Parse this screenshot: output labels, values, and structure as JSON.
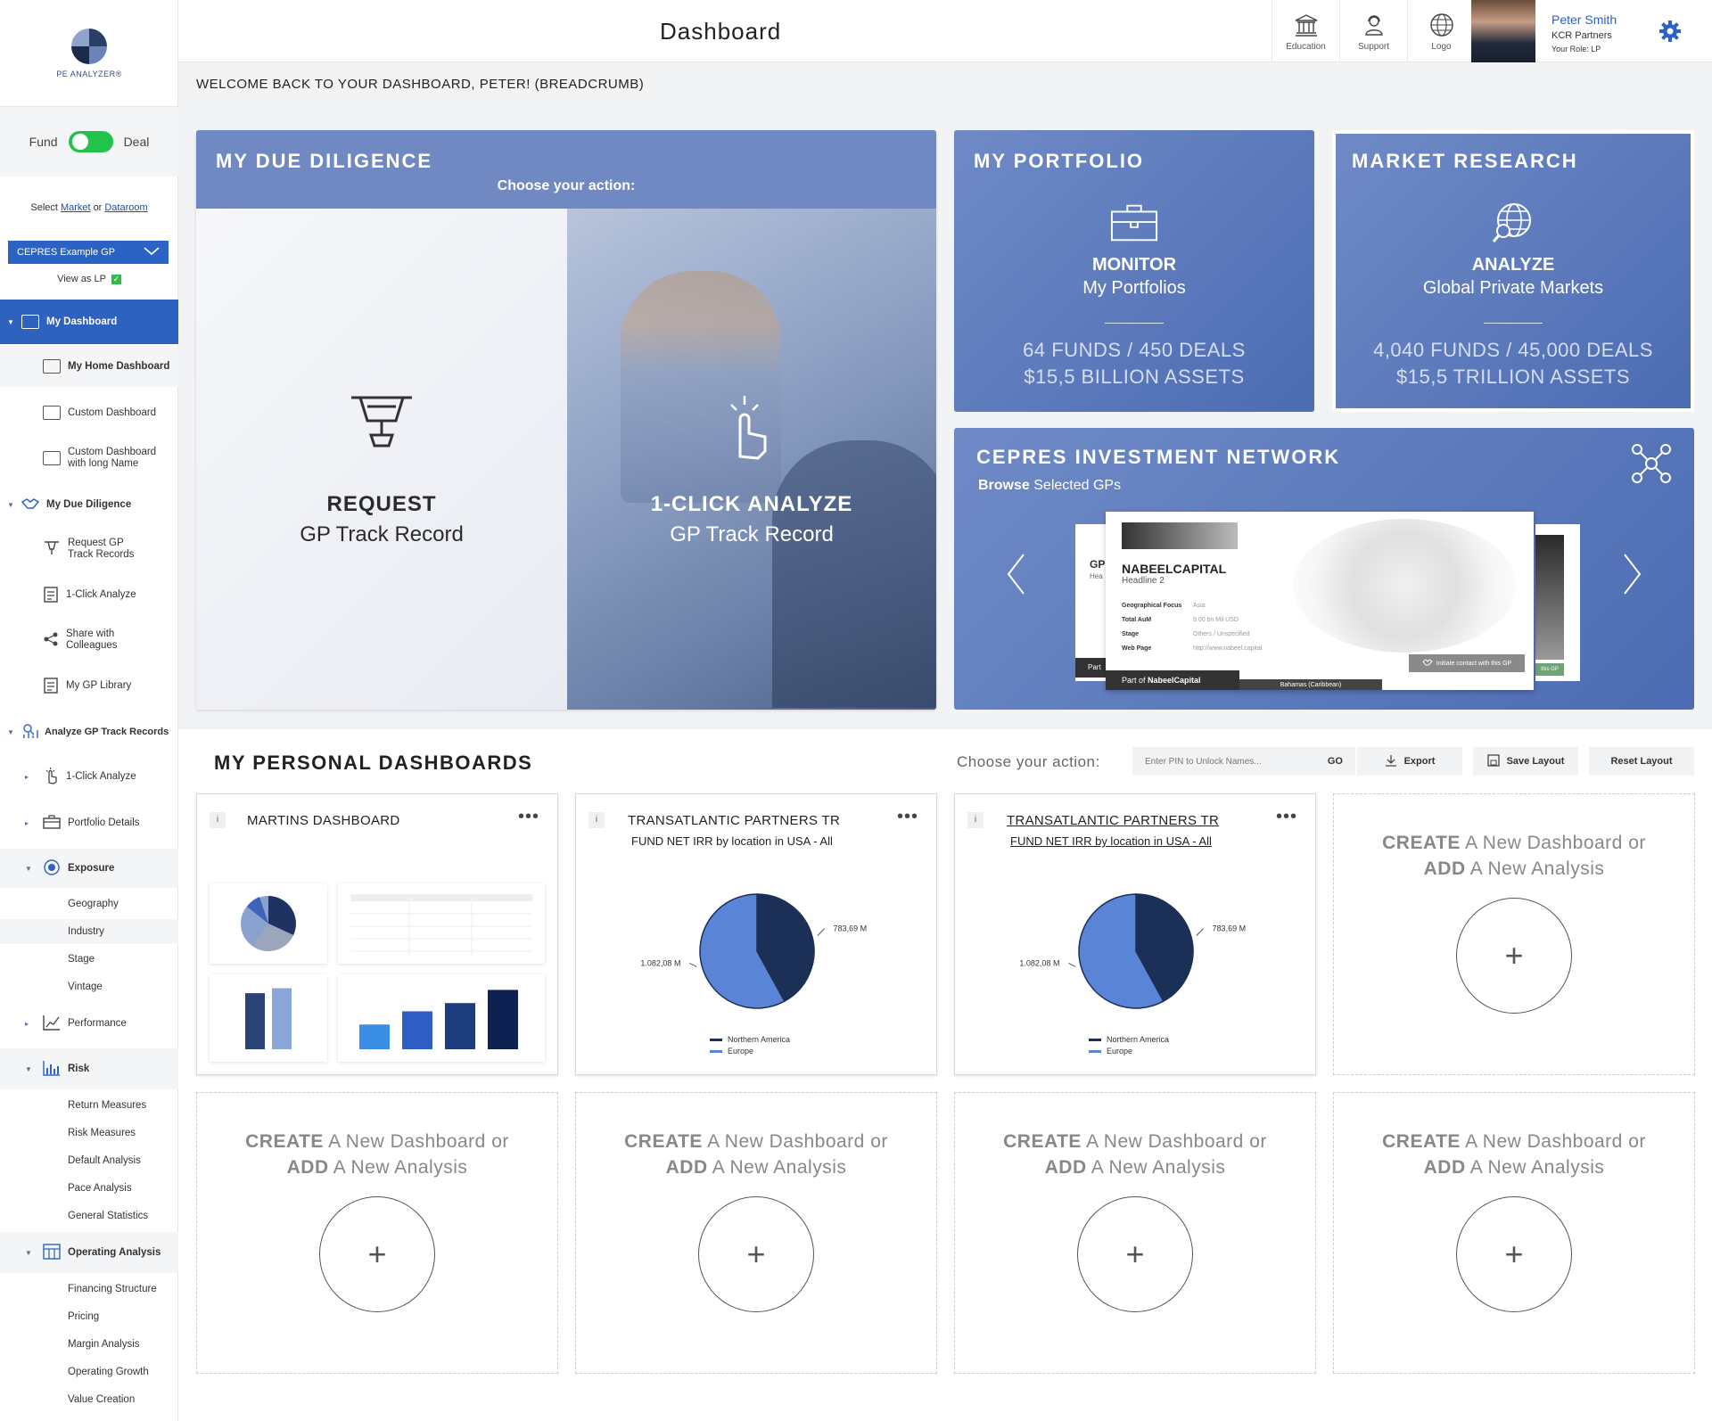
{
  "app": {
    "logo_text": "PE ANALYZER®",
    "page_title": "Dashboard",
    "breadcrumb": "WELCOME BACK TO YOUR DASHBOARD, PETER! (BREADCRUMB)"
  },
  "header": {
    "items": [
      {
        "label": "Education",
        "icon": "education-icon"
      },
      {
        "label": "Support",
        "icon": "support-icon"
      },
      {
        "label": "Logo",
        "icon": "globe-logo-icon"
      }
    ],
    "user": {
      "name": "Peter Smith",
      "company": "KCR Partners",
      "role": "Your Role: LP"
    }
  },
  "sidebar": {
    "toggle": {
      "left": "Fund",
      "right": "Deal",
      "on": true
    },
    "select_prefix": "Select",
    "select_market": "Market",
    "select_or": "or",
    "select_dataroom": "Dataroom",
    "gp_select": "CEPRES Example GP",
    "view_as_lp": "View as LP",
    "nav": {
      "my_dashboard": "My Dashboard",
      "my_home_dashboard": "My Home Dashboard",
      "custom_dashboard": "Custom Dashboard",
      "custom_dashboard_long_1": "Custom Dashboard",
      "custom_dashboard_long_2": "with long Name",
      "my_due_diligence": "My Due Diligence",
      "request_gp_1": "Request GP",
      "request_gp_2": "Track Records",
      "one_click": "1-Click Analyze",
      "share_1": "Share with",
      "share_2": "Colleagues",
      "gp_library": "My GP Library",
      "analyze_gp": "Analyze GP Track Records",
      "one_click_2": "1-Click Analyze",
      "portfolio_details": "Portfolio Details",
      "exposure": "Exposure",
      "geography": "Geography",
      "industry": "Industry",
      "stage": "Stage",
      "vintage": "Vintage",
      "performance": "Performance",
      "risk": "Risk",
      "return_measures": "Return Measures",
      "risk_measures": "Risk Measures",
      "default_analysis": "Default Analysis",
      "pace_analysis": "Pace Analysis",
      "general_statistics": "General Statistics",
      "operating_analysis": "Operating Analysis",
      "financing_structure": "Financing Structure",
      "pricing": "Pricing",
      "margin_analysis": "Margin Analysis",
      "operating_growth": "Operating Growth",
      "value_creation": "Value Creation"
    }
  },
  "due_diligence": {
    "title": "MY DUE DILIGENCE",
    "subtitle": "Choose your action:",
    "left": {
      "bold": "REQUEST",
      "text": "GP Track Record"
    },
    "right": {
      "bold": "1-CLICK ANALYZE",
      "text": "GP Track Record"
    }
  },
  "portfolio": {
    "title": "MY PORTFOLIO",
    "bold": "MONITOR",
    "text": "My Portfolios",
    "stat1": "64 FUNDS / 450 DEALS",
    "stat2": "$15,5 BILLION ASSETS"
  },
  "market_research": {
    "title": "MARKET RESEARCH",
    "bold": "ANALYZE",
    "text": "Global Private Markets",
    "stat1": "4,040 FUNDS / 45,000 DEALS",
    "stat2": "$15,5 TRILLION ASSETS"
  },
  "network": {
    "title": "CEPRES INVESTMENT NETWORK",
    "sub_bold": "Browse",
    "sub_text": "Selected GPs",
    "card": {
      "name": "NABEELCAPITAL",
      "headline": "Headline 2",
      "fields": [
        {
          "k": "Geographical Focus",
          "v": "Asia"
        },
        {
          "k": "Total AuM",
          "v": "9.00 bn Mil USD"
        },
        {
          "k": "Stage",
          "v": "Others / Unspecified"
        },
        {
          "k": "Web Page",
          "v": "http://www.nabeel.capital"
        }
      ],
      "button": "Initiate contact with this GP",
      "part_of_prefix": "Part of",
      "part_of": "NabeelCapital",
      "location": "Bahamas (Caribbean)",
      "back_label": "GP",
      "back_sub": "Hea",
      "back_part": "Part",
      "back_right_btn": "this GP"
    }
  },
  "personal": {
    "title": "MY PERSONAL DASHBOARDS",
    "choose": "Choose your action:",
    "pin_placeholder": "Enter PIN to Unlock Names...",
    "go": "GO",
    "export": "Export",
    "save_layout": "Save Layout",
    "reset_layout": "Reset Layout",
    "create_bold1": "CREATE",
    "create_text1": "A New Dashboard or",
    "create_bold2": "ADD",
    "create_text2": "A New Analysis",
    "plus": "+",
    "info": "i",
    "dots": "•••",
    "cards": [
      {
        "title": "MARTINS DASHBOARD"
      },
      {
        "title": "TRANSATLANTIC PARTNERS TR",
        "subtitle": "FUND NET IRR by location in USA - All"
      },
      {
        "title": "TRANSATLANTIC PARTNERS TR",
        "subtitle": "FUND NET IRR by location in USA - All"
      }
    ]
  },
  "chart_data": [
    {
      "type": "pie",
      "title": "FUND NET IRR by location in USA - All",
      "series": [
        {
          "name": "Northern America",
          "value": 783.69,
          "label": "783,69 M",
          "color": "#1c2f57"
        },
        {
          "name": "Europe",
          "value": 1082.08,
          "label": "1.082,08 M",
          "color": "#5a84d6"
        }
      ],
      "legend": "bottom"
    },
    {
      "type": "pie",
      "title": "FUND NET IRR by location in USA - All",
      "series": [
        {
          "name": "Northern America",
          "value": 783.69,
          "label": "783,69 M",
          "color": "#1c2f57"
        },
        {
          "name": "Europe",
          "value": 1082.08,
          "label": "1.082,08 M",
          "color": "#5a84d6"
        }
      ],
      "legend": "bottom"
    },
    {
      "type": "bar",
      "values": [
        68,
        74
      ],
      "colors": [
        "#2b4478",
        "#8aa6d8"
      ]
    },
    {
      "type": "bar",
      "values": [
        30,
        46,
        56,
        72
      ],
      "colors": [
        "#3a8ee6",
        "#2f5fc4",
        "#1c3c7e",
        "#0f2150"
      ]
    }
  ]
}
